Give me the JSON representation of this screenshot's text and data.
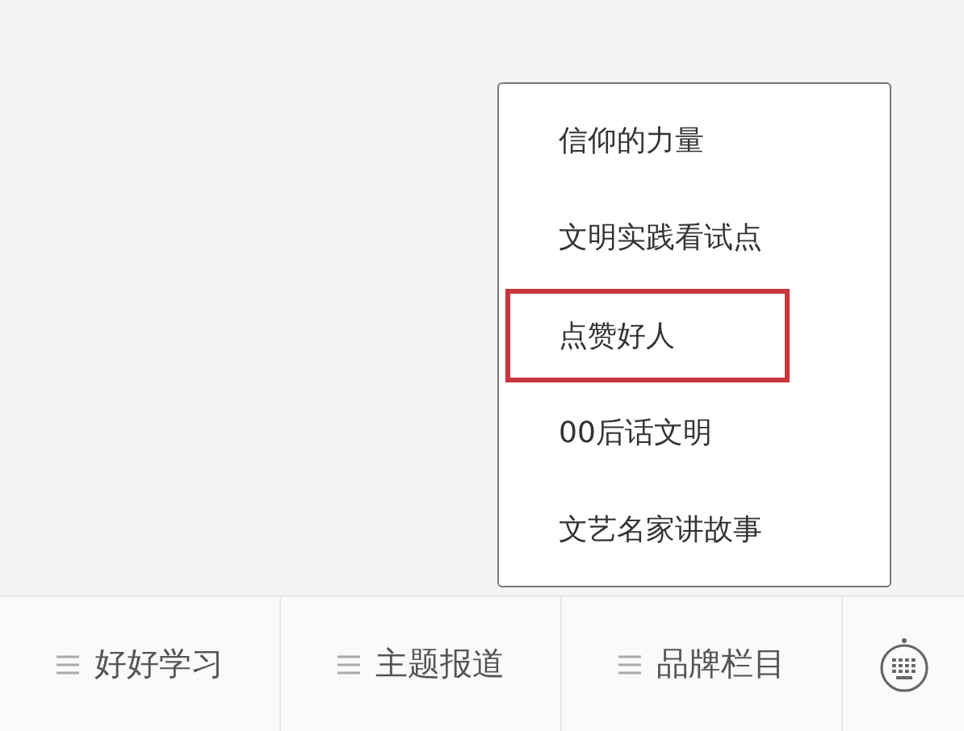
{
  "popup_menu": {
    "items": [
      {
        "label": "信仰的力量",
        "selected": false
      },
      {
        "label": "文明实践看试点",
        "selected": false
      },
      {
        "label": "点赞好人",
        "selected": true
      },
      {
        "label": "00后话文明",
        "selected": false
      },
      {
        "label": "文艺名家讲故事",
        "selected": false
      }
    ]
  },
  "bottom_menu": {
    "items": [
      {
        "label": "好好学习"
      },
      {
        "label": "主题报道"
      },
      {
        "label": "品牌栏目"
      }
    ]
  }
}
